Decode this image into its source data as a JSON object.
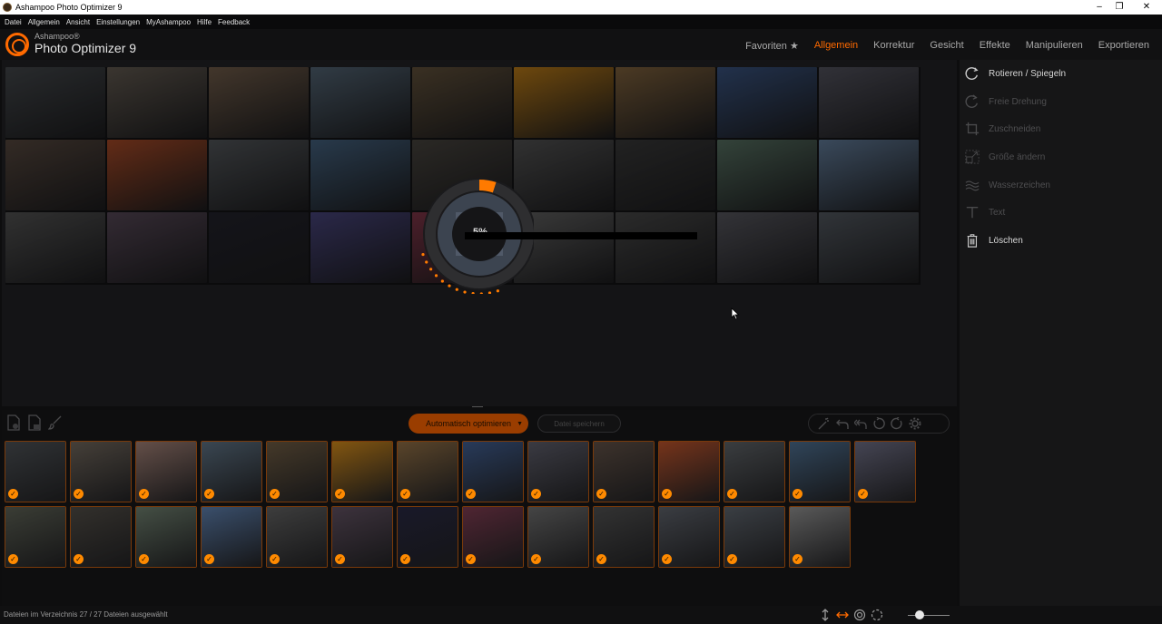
{
  "window": {
    "title": "Ashampoo Photo Optimizer 9"
  },
  "menu": [
    "Datei",
    "Allgemein",
    "Ansicht",
    "Einstellungen",
    "MyAshampoo",
    "Hilfe",
    "Feedback"
  ],
  "brand": {
    "small": "Ashampoo®",
    "big": "Photo Optimizer 9"
  },
  "tabs": [
    {
      "label": "Favoriten ★",
      "active": false
    },
    {
      "label": "Allgemein",
      "active": true
    },
    {
      "label": "Korrektur",
      "active": false
    },
    {
      "label": "Gesicht",
      "active": false
    },
    {
      "label": "Effekte",
      "active": false
    },
    {
      "label": "Manipulieren",
      "active": false
    },
    {
      "label": "Exportieren",
      "active": false
    }
  ],
  "sidebar": {
    "items": [
      {
        "label": "Rotieren / Spiegeln",
        "icon": "rotate-icon",
        "enabled": true
      },
      {
        "label": "Freie Drehung",
        "icon": "free-rotate-icon",
        "enabled": false
      },
      {
        "label": "Zuschneiden",
        "icon": "crop-icon",
        "enabled": false
      },
      {
        "label": "Größe ändern",
        "icon": "resize-icon",
        "enabled": false
      },
      {
        "label": "Wasserzeichen",
        "icon": "watermark-icon",
        "enabled": false
      },
      {
        "label": "Text",
        "icon": "text-icon",
        "enabled": false
      },
      {
        "label": "Löschen",
        "icon": "trash-icon",
        "enabled": true
      }
    ]
  },
  "progress": {
    "label": "5%",
    "value": 0.05
  },
  "toolbar": {
    "auto_optimize": "Automatisch optimieren",
    "save": "Datei speichern"
  },
  "collage_colors": [
    "#4a4e52",
    "#6b6258",
    "#7a6450",
    "#5a6d7e",
    "#6a5840",
    "#c8841a",
    "#8a6a42",
    "#3e5a8a",
    "#5a5a66",
    "#5e4e44",
    "#b4502a",
    "#5a5e62",
    "#4a6a8a",
    "#4e4a44",
    "#5a5a5a",
    "#3e3e3e",
    "#5e7a6a",
    "#6a86a6",
    "#5a5a5a",
    "#5e4e5e",
    "#262630",
    "#4e4a86",
    "#8a3a4e",
    "#6a6a6a",
    "#4e4e4e",
    "#5e5e66",
    "#5a6068"
  ],
  "thumb_colors": [
    "#4a4e52",
    "#6b6258",
    "#9a7a70",
    "#5a6d7e",
    "#6a5840",
    "#c8841a",
    "#8a6a42",
    "#3e5a8a",
    "#5a5a66",
    "#5e4e44",
    "#b4502a",
    "#5a5e62",
    "#4a6a8a",
    "#6a6a80",
    "#5a5e52",
    "#4e4a44",
    "#6a7a6a",
    "#5a7aa6",
    "#5e5e5e",
    "#5e4e5e",
    "#262640",
    "#7a3a4e",
    "#6a6a6a",
    "#4e4e4e",
    "#5a5e66",
    "#5a6068",
    "#8a8a8a"
  ],
  "status": {
    "text": "Dateien im Verzeichnis 27 / 27 Dateien ausgewählt"
  },
  "colors": {
    "accent": "#ff6a00"
  }
}
